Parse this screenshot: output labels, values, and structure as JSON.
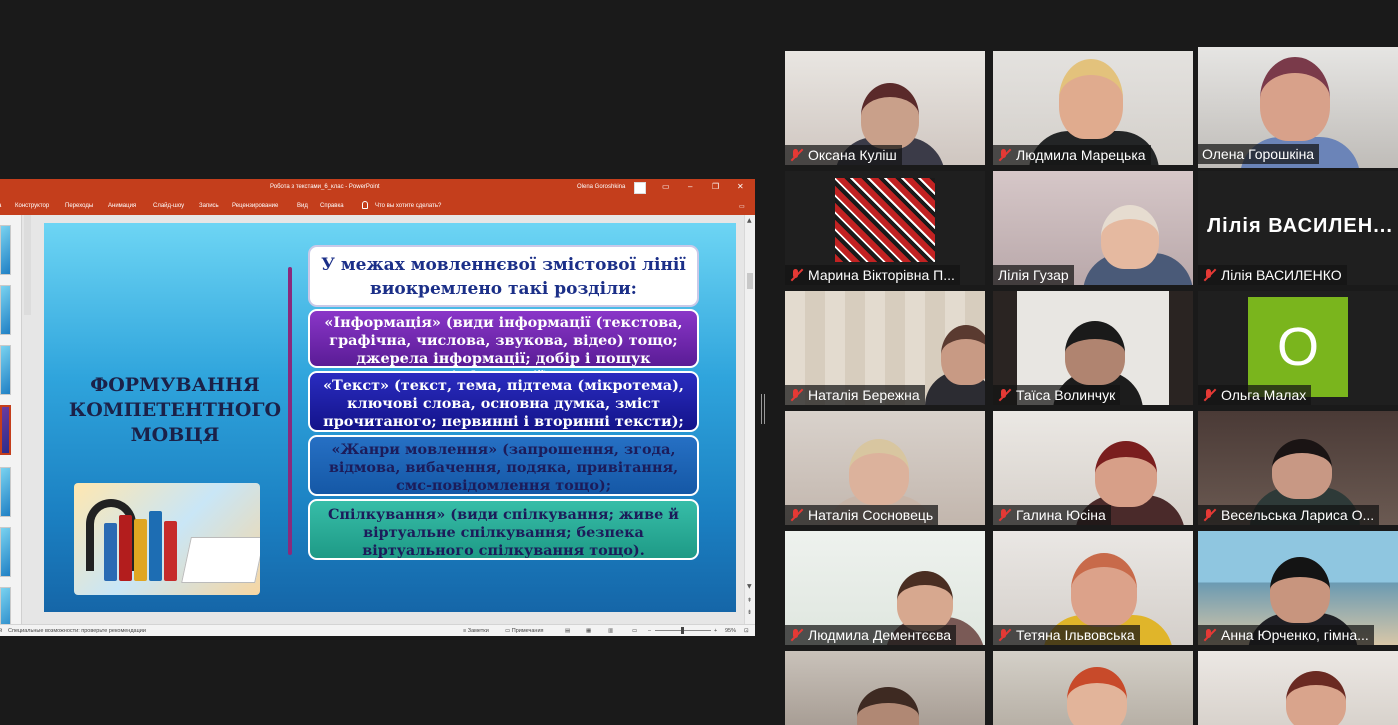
{
  "ppt": {
    "window_title": "Робота з текстами_6_клас  -  PowerPoint",
    "user": "Olena Goroshkina",
    "ribbon_tabs": [
      "Конструктор",
      "Переходы",
      "Анимация",
      "Слайд-шоу",
      "Запись",
      "Рецензирование",
      "Вид",
      "Справка"
    ],
    "tell_me": "Что вы хотите сделать?",
    "status_accessibility": "Специальные возможности: проверьте рекомендации",
    "status_notes": "Заметки",
    "status_comments": "Примечания",
    "zoom": "95%"
  },
  "slide": {
    "title": "ФОРМУВАННЯ КОМПЕТЕНТНОГО МОВЦЯ",
    "header_box": "У межах мовленнєвої змістової лінії виокремлено такі розділи:",
    "box_info": "«Інформація» (види інформації (текстова, графічна, числова, звукова, відео) тощо; джерела інформації; добір і пошук інформації);",
    "box_text": "«Текст» (текст, тема, підтема (мікротема), ключові слова,  основна думка, зміст прочитаного;  первинні і вторинні тексти);",
    "box_genres": "«Жанри мовлення» (запрошення, згода, відмова, вибачення, подяка, привітання, смс-повідомлення тощо);",
    "box_comm": "Спілкування» (види спілкування; живе й віртуальне спілкування; безпека віртуального спілкування тощо)."
  },
  "participants": [
    {
      "name": "Оксана Куліш",
      "muted": true
    },
    {
      "name": "Людмила Марецька",
      "muted": true
    },
    {
      "name": "Олена Горошкіна",
      "muted": false,
      "active": true
    },
    {
      "name": "Марина Вікторівна П...",
      "muted": true
    },
    {
      "name": "Лілія Гузар",
      "muted": false
    },
    {
      "name": "Лілія ВАСИЛЕНКО",
      "muted": true,
      "big_label": "Лілія  ВАСИЛЕН..."
    },
    {
      "name": "Наталія Бережна",
      "muted": true
    },
    {
      "name": "Таїса Волинчук",
      "muted": true
    },
    {
      "name": "Ольга Малах",
      "muted": true,
      "avatar_letter": "O"
    },
    {
      "name": "Наталія Сосновець",
      "muted": true
    },
    {
      "name": "Галина Юсіна",
      "muted": true
    },
    {
      "name": "Весельська Лариса О...",
      "muted": true
    },
    {
      "name": "Людмила Дементєєва",
      "muted": true
    },
    {
      "name": "Тетяна Ільвовська",
      "muted": true
    },
    {
      "name": "Анна  Юрченко, гімна...",
      "muted": true
    },
    {
      "name": "",
      "muted": false
    },
    {
      "name": "",
      "muted": false
    },
    {
      "name": "",
      "muted": false
    }
  ],
  "colors": {
    "ppt_accent": "#c43e1c",
    "active_speaker": "#c9e65a",
    "muted": "#e53935",
    "avatar_green": "#7ab51d"
  }
}
